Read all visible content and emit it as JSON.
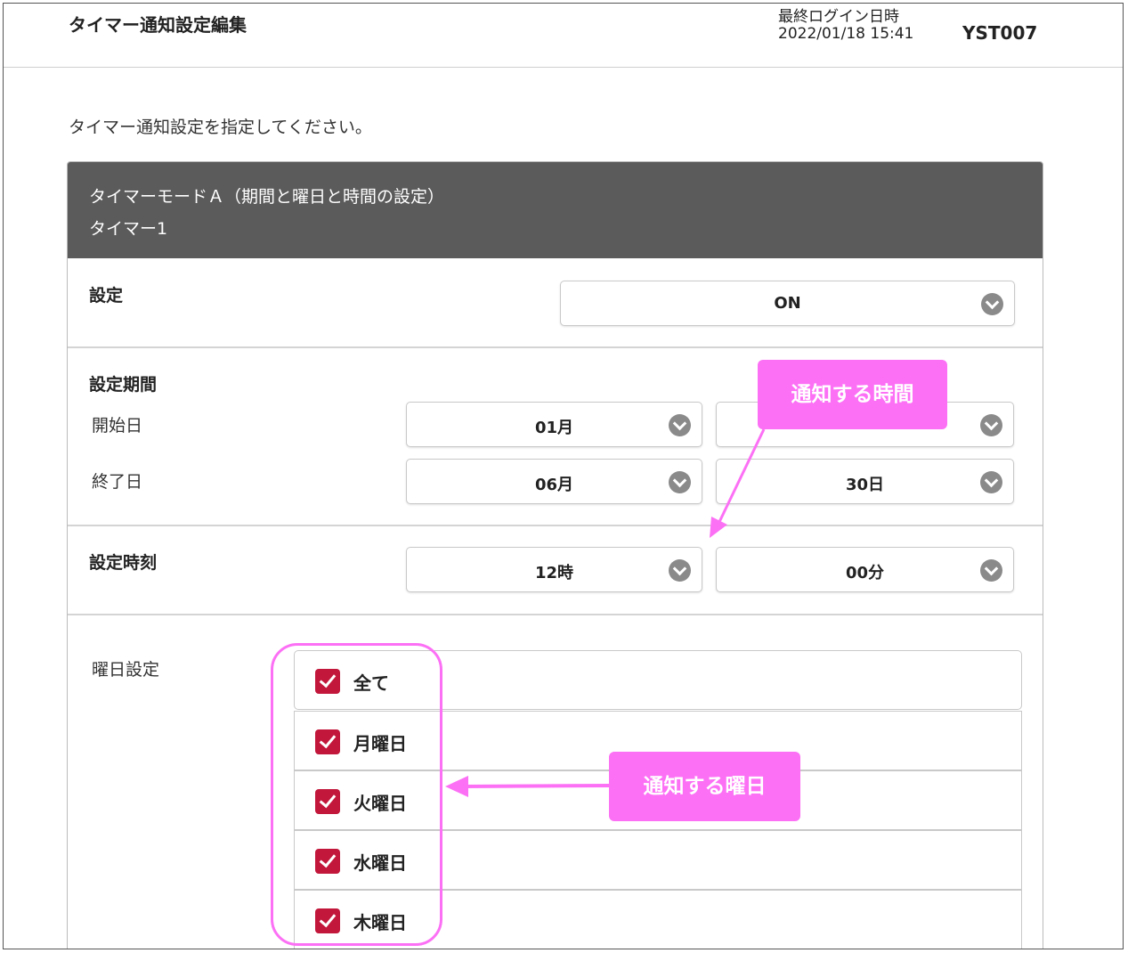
{
  "header": {
    "title": "タイマー通知設定編集",
    "last_login_label": "最終ログイン日時",
    "last_login_value": "2022/01/18 15:41",
    "user_id": "YST007"
  },
  "instruction": "タイマー通知設定を指定してください。",
  "panel": {
    "mode_title": "タイマーモードＡ（期間と曜日と時間の設定）",
    "timer_name": "タイマー1",
    "setting": {
      "label": "設定",
      "value": "ON"
    },
    "period": {
      "label": "設定期間",
      "start_label": "開始日",
      "start_month": "01月",
      "start_day": "",
      "end_label": "終了日",
      "end_month": "06月",
      "end_day": "30日"
    },
    "time": {
      "label": "設定時刻",
      "hour": "12時",
      "minute": "00分"
    },
    "weekdays": {
      "label": "曜日設定",
      "items": [
        {
          "label": "全て",
          "checked": true
        },
        {
          "label": "月曜日",
          "checked": true
        },
        {
          "label": "火曜日",
          "checked": true
        },
        {
          "label": "水曜日",
          "checked": true
        },
        {
          "label": "木曜日",
          "checked": true
        }
      ]
    }
  },
  "annotations": {
    "time_callout": "通知する時間",
    "weekday_callout": "通知する曜日",
    "color": "#fc70f5"
  },
  "colors": {
    "panel_header": "#5b5b5b",
    "checkbox": "#c2163a",
    "chevron": "#8a8a8a"
  }
}
